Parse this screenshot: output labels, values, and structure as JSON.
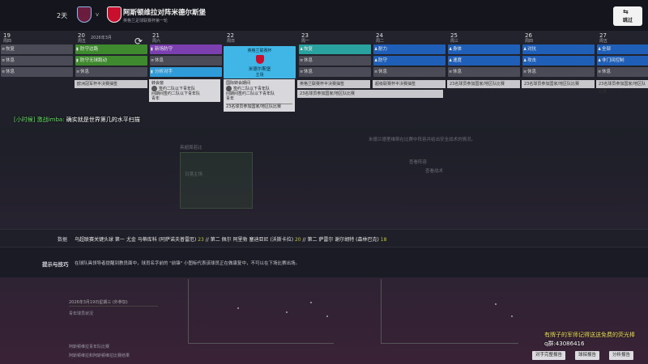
{
  "header": {
    "day_count": "2天",
    "vs": "v",
    "title": "阿斯顿维拉对阵米德尔斯堡",
    "subtitle": "英格兰足球联赛杯第一轮",
    "skip_label": "跳过"
  },
  "calendar": {
    "month_label": "2026年3月",
    "columns": [
      {
        "num": "19",
        "dow": "周四",
        "cells": [
          {
            "label": "恢复",
            "style": "rest"
          },
          {
            "label": "休息",
            "style": "rest"
          },
          {
            "label": "休息",
            "style": "rest"
          }
        ]
      },
      {
        "num": "20",
        "dow": "周五",
        "cells": [
          {
            "label": "防守边路",
            "style": "green"
          },
          {
            "label": "防守无球跑动",
            "style": "green"
          },
          {
            "label": "休息",
            "style": "rest"
          }
        ]
      },
      {
        "num": "21",
        "dow": "周六",
        "cells": [
          {
            "label": "新场防守",
            "style": "purple"
          },
          {
            "label": "休息",
            "style": "rest"
          },
          {
            "label": "分析对手",
            "style": "lblue"
          }
        ]
      },
      {
        "num": "22",
        "dow": "周日",
        "cells": []
      },
      {
        "num": "23",
        "dow": "周一",
        "cells": [
          {
            "label": "恢复",
            "style": "teal"
          },
          {
            "label": "休息",
            "style": "rest"
          },
          {
            "label": "休息",
            "style": "rest"
          }
        ]
      },
      {
        "num": "24",
        "dow": "周二",
        "cells": [
          {
            "label": "耐力",
            "style": "blue"
          },
          {
            "label": "防守",
            "style": "blue"
          },
          {
            "label": "休息",
            "style": "rest"
          }
        ]
      },
      {
        "num": "25",
        "dow": "周三",
        "cells": [
          {
            "label": "身体",
            "style": "blue"
          },
          {
            "label": "速度",
            "style": "blue"
          },
          {
            "label": "休息",
            "style": "rest"
          }
        ]
      },
      {
        "num": "26",
        "dow": "周四",
        "cells": [
          {
            "label": "对抗",
            "style": "blue"
          },
          {
            "label": "攻击",
            "style": "blue"
          },
          {
            "label": "休息",
            "style": "rest"
          }
        ]
      },
      {
        "num": "27",
        "dow": "周五",
        "cells": [
          {
            "label": "全部",
            "style": "blue"
          },
          {
            "label": "非门间控制",
            "style": "blue"
          },
          {
            "label": "休息",
            "style": "rest"
          }
        ]
      }
    ],
    "match_card": {
      "top": "英格兰联赛杯",
      "name": "米德尔斯堡",
      "venue": "主场"
    }
  },
  "strip": {
    "box1": "欧洲冠军杯半决赛抽签",
    "box2": "英格兰联赛杯半决赛抽签",
    "box3": "超级联赛杯半决赛抽签",
    "box4": "23名球员参加国家/地区队比赛",
    "box5": "23名球员参加国家/地区队比赛",
    "box6": "23名球员参加国家/地区队比赛",
    "box7": "23名球员参加国家/地区队比赛",
    "popup1_title": "转会窗",
    "popup1_line1": "签约二队以下青年队",
    "popup1_line2": "间期间签约二队以下青年队",
    "popup1_line3": "青年",
    "popup2_title": "国际转会期间",
    "popup2_line1": "签约二队以下青年队",
    "popup2_line2": "间期间签约二队以下青年队",
    "popup2_line3": "青年",
    "popup2_footer": "23名球员参加国家/地区队比赛"
  },
  "chat": {
    "user": "[小时候] 激战imba:",
    "message": "确实就是世界第几的水平扫描"
  },
  "data_row": {
    "label": "数据",
    "text_a": "乌超联赛关键头球  第一  尤金 马蒂库科 (阿萨诺夫普雷厄) ",
    "num_a": "23",
    "text_b": " // 第二 佩尔 阿里勃 塞迪亚尼 (沃斯卡拉) ",
    "num_b": "20",
    "text_c": " // 第二 萨雷尔 谢尔胡特 (森林巴克) ",
    "num_c": "18"
  },
  "tips": {
    "label": "提示与技巧",
    "text": "在球队具领导者提醒到教员面中，球员名字前的 \"前锋\" 小图标代表该球员正在做康复中，不可以在下场比赛出场。"
  },
  "feed": {
    "date": "2026年3月19日星期三 (外参加)",
    "item1": "青年球员状况",
    "item2": "阿斯顿维拉青年队比赛",
    "item3": "阿斯顿维拉和阿斯顿维拉比赛结果"
  },
  "ghost": {
    "t1": "米德兰德里维斯在比赛中阵容并给出安全战术的情况。",
    "t2": "查看阵容",
    "t3": "查看战术",
    "t4": "英超周若比",
    "t5": "日落主场"
  },
  "overlay": {
    "promo": "有牌子的军师记得送送免费的荧光棒",
    "qq": "q群:43086416"
  },
  "bottom_buttons": [
    "对手完整报告",
    "球探报告",
    "分析报告"
  ]
}
